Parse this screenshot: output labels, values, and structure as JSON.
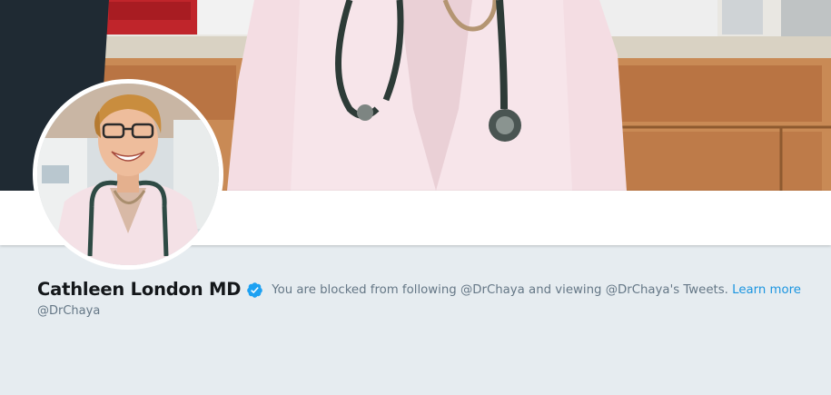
{
  "profile": {
    "name": "Cathleen London MD",
    "handle": "@DrChaya",
    "verified": true
  },
  "blocked": {
    "message": "You are blocked from following @DrChaya and viewing @DrChaya's Tweets.",
    "learn_more_label": "Learn more"
  },
  "colors": {
    "background": "#e6ecf0",
    "link": "#1b95e0",
    "verified_badge": "#1da1f2",
    "muted_text": "#657786",
    "name_text": "#14171a"
  },
  "icons": {
    "verified": "verified-badge-icon"
  }
}
